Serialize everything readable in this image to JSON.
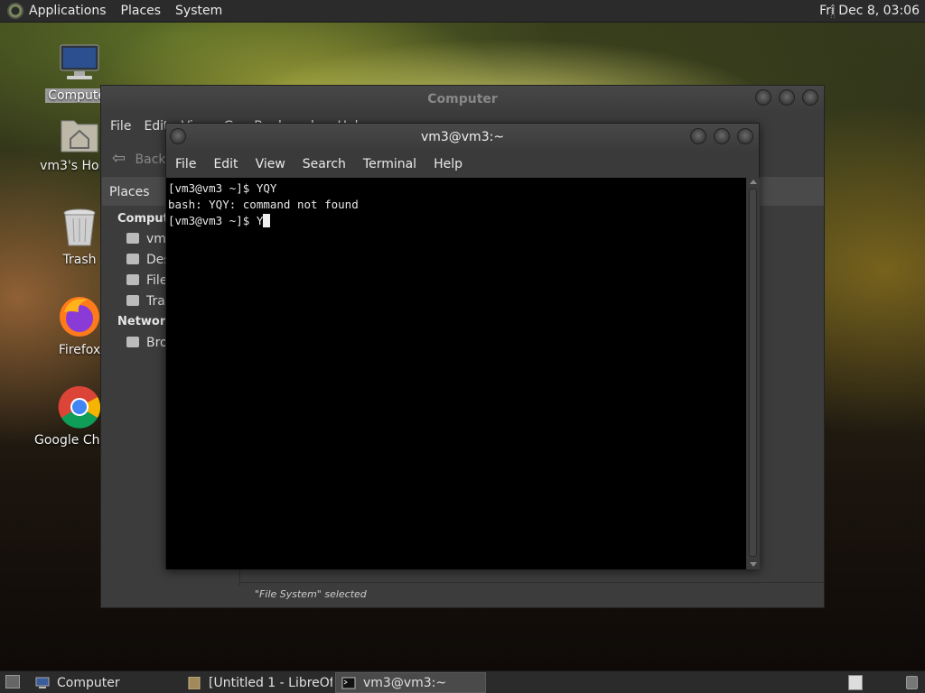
{
  "top_panel": {
    "menus": [
      "Applications",
      "Places",
      "System"
    ],
    "clock": "Fri Dec  8, 03:06"
  },
  "desktop_icons": [
    {
      "label": "Computer",
      "icon": "computer-icon",
      "selected": true
    },
    {
      "label": "vm3's Home",
      "icon": "home-folder-icon"
    },
    {
      "label": "Trash",
      "icon": "trash-icon"
    },
    {
      "label": "Firefox",
      "icon": "firefox-icon"
    },
    {
      "label": "Google Chrome",
      "icon": "chrome-icon"
    }
  ],
  "file_manager": {
    "title": "Computer",
    "menus": [
      "File",
      "Edit",
      "View",
      "Go",
      "Bookmarks",
      "Help"
    ],
    "back_label": "Back",
    "places_label": "Places",
    "sidebar": {
      "computer_heading": "Computer",
      "computer_items": [
        "vm3",
        "Desktop",
        "File System",
        "Trash"
      ],
      "network_heading": "Network",
      "network_items": [
        "Browse Network"
      ]
    },
    "status": "\"File System\" selected"
  },
  "terminal": {
    "title": "vm3@vm3:~",
    "menus": [
      "File",
      "Edit",
      "View",
      "Search",
      "Terminal",
      "Help"
    ],
    "lines": [
      "[vm3@vm3 ~]$ YQY",
      "bash: YQY: command not found",
      "[vm3@vm3 ~]$ Y"
    ]
  },
  "taskbar": {
    "tasks": [
      {
        "label": "Computer",
        "icon": "folder-icon"
      },
      {
        "label": "[Untitled 1 - LibreOf…",
        "icon": "libreoffice-icon"
      },
      {
        "label": "vm3@vm3:~",
        "icon": "terminal-icon",
        "active": true
      }
    ]
  },
  "colors": {
    "panel": "#2b2b2b",
    "window": "#3c3c3c",
    "terminal_bg": "#000000"
  }
}
